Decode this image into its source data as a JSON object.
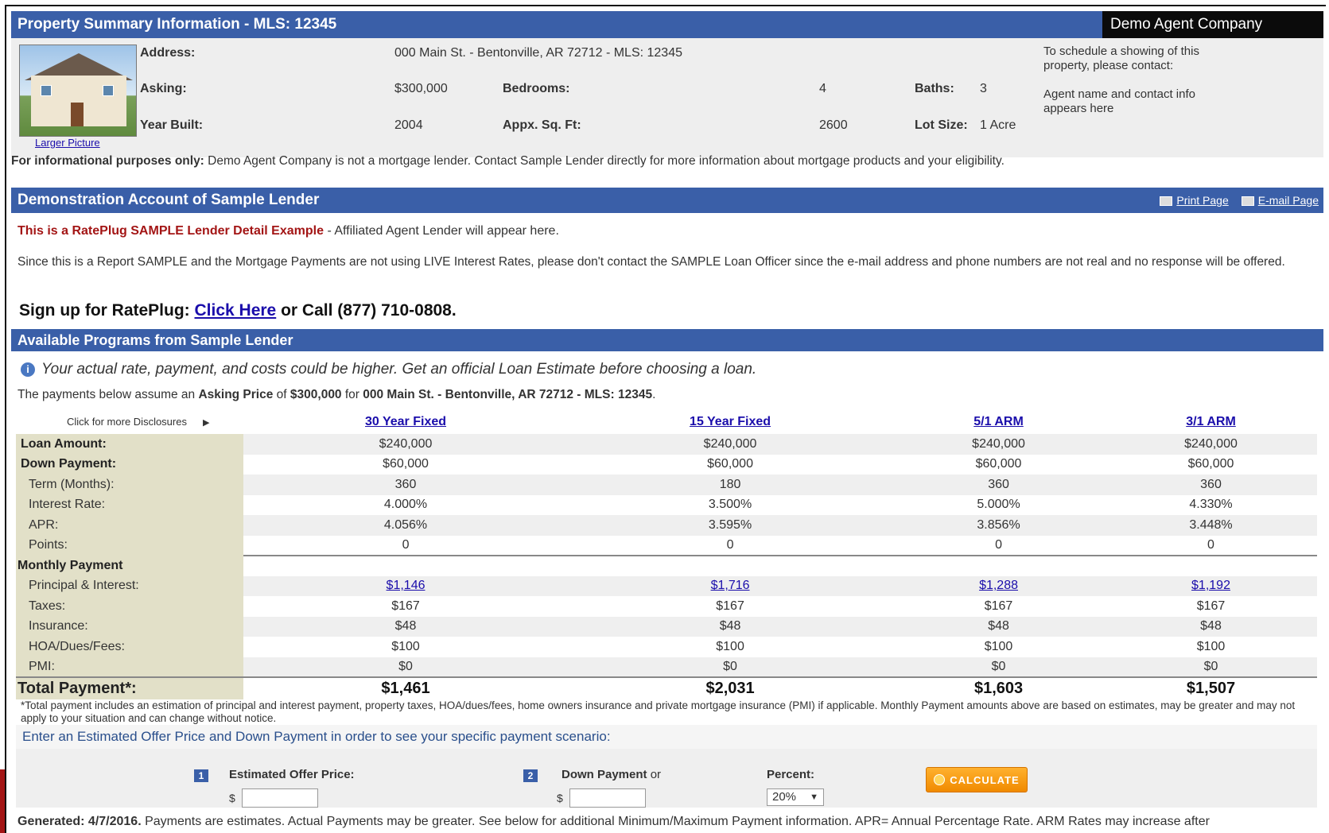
{
  "header": {
    "title": "Property Summary Information - MLS: 12345",
    "agent_company": "Demo Agent Company"
  },
  "property": {
    "larger_picture": "Larger Picture",
    "address_label": "Address:",
    "address_value": "000 Main St. - Bentonville, AR 72712 - MLS: 12345",
    "asking_label": "Asking:",
    "asking_value": "$300,000",
    "bedrooms_label": "Bedrooms:",
    "bedrooms_value": "4",
    "baths_label": "Baths:",
    "baths_value": "3",
    "year_label": "Year Built:",
    "year_value": "2004",
    "sqft_label": "Appx. Sq. Ft:",
    "sqft_value": "2600",
    "lot_label": "Lot Size:",
    "lot_value": "1 Acre",
    "contact_line1": "To schedule a showing of this property, please contact:",
    "contact_line2": "Agent name and contact info appears here"
  },
  "info_line": {
    "bold": "For informational purposes only:",
    "text": " Demo Agent Company is not a mortgage lender. Contact Sample Lender directly for more information about mortgage products and your eligibility."
  },
  "lender": {
    "title": "Demonstration Account of Sample Lender",
    "print": "Print Page",
    "email": "E-mail Page",
    "sample_bold": "This is a RatePlug SAMPLE Lender Detail Example",
    "sample_text": " - Affiliated Agent Lender will appear here.",
    "since": "Since this is a Report SAMPLE and the Mortgage Payments are not using LIVE Interest Rates, please don't contact the SAMPLE Loan Officer since the e-mail address and phone numbers are not real and no response will be offered.",
    "signup_prefix": "Sign up for RatePlug: ",
    "signup_link": "Click Here",
    "signup_suffix": " or Call (877) 710-0808."
  },
  "programs": {
    "title": "Available Programs from Sample Lender",
    "notice": "Your actual rate, payment, and costs could be higher. Get an official Loan Estimate before choosing a loan.",
    "assume_prefix": "The payments below assume an ",
    "assume_b1": "Asking Price",
    "assume_mid": " of ",
    "assume_b2": "$300,000",
    "assume_for": " for ",
    "assume_b3": "000 Main St. - Bentonville, AR 72712 - MLS: 12345",
    "assume_end": ".",
    "disclosures": "Click for more Disclosures",
    "columns": [
      "30 Year Fixed",
      "15 Year Fixed",
      "5/1 ARM",
      "3/1 ARM"
    ],
    "loan_amount_label": "Loan Amount:",
    "loan_amount": [
      "$240,000",
      "$240,000",
      "$240,000",
      "$240,000"
    ],
    "down_payment_label": "Down Payment:",
    "down_payment": [
      "$60,000",
      "$60,000",
      "$60,000",
      "$60,000"
    ],
    "term_label": "Term (Months):",
    "term": [
      "360",
      "180",
      "360",
      "360"
    ],
    "rate_label": "Interest Rate:",
    "rate": [
      "4.000%",
      "3.500%",
      "5.000%",
      "4.330%"
    ],
    "apr_label": "APR:",
    "apr": [
      "4.056%",
      "3.595%",
      "3.856%",
      "3.448%"
    ],
    "points_label": "Points:",
    "points": [
      "0",
      "0",
      "0",
      "0"
    ],
    "monthly_label": "Monthly Payment",
    "pi_label": "Principal & Interest:",
    "pi": [
      "$1,146",
      "$1,716",
      "$1,288",
      "$1,192"
    ],
    "taxes_label": "Taxes:",
    "taxes": [
      "$167",
      "$167",
      "$167",
      "$167"
    ],
    "insurance_label": "Insurance:",
    "insurance": [
      "$48",
      "$48",
      "$48",
      "$48"
    ],
    "hoa_label": "HOA/Dues/Fees:",
    "hoa": [
      "$100",
      "$100",
      "$100",
      "$100"
    ],
    "pmi_label": "PMI:",
    "pmi": [
      "$0",
      "$0",
      "$0",
      "$0"
    ],
    "total_label": "Total Payment*:",
    "total": [
      "$1,461",
      "$2,031",
      "$1,603",
      "$1,507"
    ],
    "footnote": "*Total payment includes an estimation of principal and interest payment, property taxes, HOA/dues/fees, home owners insurance and private mortgage insurance (PMI) if applicable. Monthly Payment amounts above are based on estimates, may be greater and may not apply to your situation and can change without notice."
  },
  "calculator": {
    "prompt": "Enter an Estimated Offer Price and Down Payment in order to see your specific payment scenario:",
    "step1": "1",
    "offer_label": "Estimated Offer Price:",
    "step2": "2",
    "down_label": "Down Payment",
    "or": "or",
    "percent_label": "Percent:",
    "dollar": "$",
    "percent_value": "20%",
    "calculate": "CALCULATE"
  },
  "generated": {
    "bold": "Generated: 4/7/2016.",
    "text": " Payments are estimates. Actual Payments may be greater. See below for additional Minimum/Maximum Payment information.   APR= Annual Percentage Rate. ARM Rates may increase after"
  },
  "colors": {
    "header_blue": "#3a5fa8",
    "label_bg": "#e2e0c8",
    "calc_orange": "#f08a00",
    "sample_red": "#a31515"
  }
}
